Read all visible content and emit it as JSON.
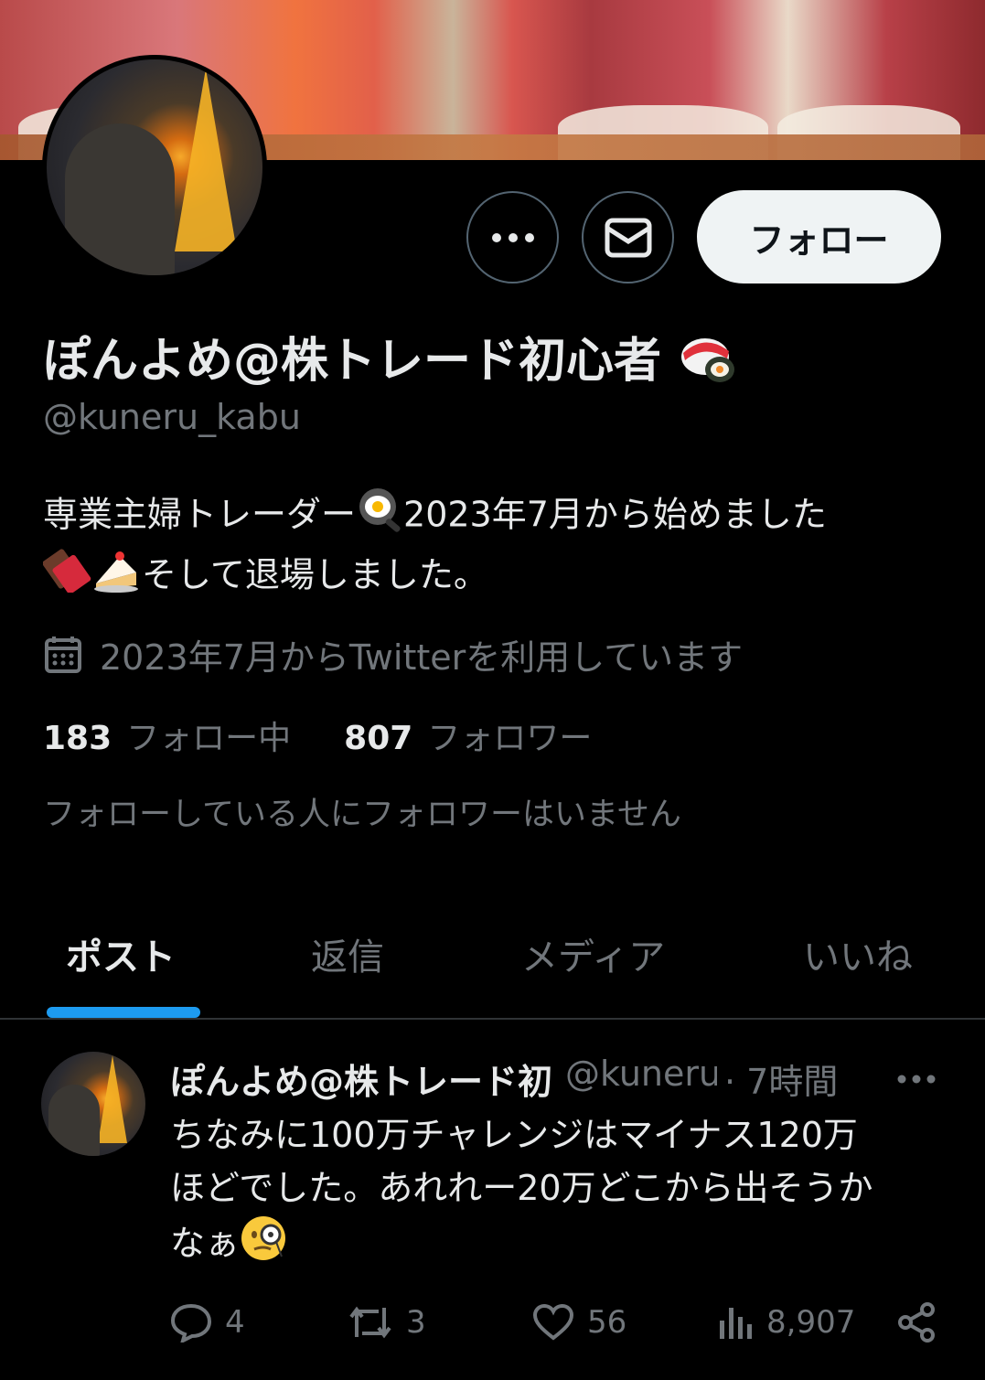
{
  "profile": {
    "display_name": "ぽんよめ@株トレード初心者",
    "handle": "@kuneru_kabu",
    "bio_line1": "専業主婦トレーダー",
    "bio_line1b": "2023年7月から始めました",
    "bio_line2": "そして退場しました。",
    "joined": "2023年7月からTwitterを利用しています",
    "following_count": "183",
    "following_label": "フォロー中",
    "followers_count": "807",
    "followers_label": "フォロワー",
    "no_mutual_followers": "フォローしている人にフォロワーはいません",
    "follow_button": "フォロー"
  },
  "tabs": [
    {
      "label": "ポスト"
    },
    {
      "label": "返信"
    },
    {
      "label": "メディア"
    },
    {
      "label": "いいね"
    }
  ],
  "post": {
    "name": "ぽんよめ@株トレード初",
    "handle": "@kuneru_",
    "time": "· 7時間",
    "text_line1": "ちなみに100万チャレンジはマイナス120万",
    "text_line2": "ほどでした。あれれー20万どこから出そうか",
    "text_line3": "なぁ",
    "replies": "4",
    "reposts": "3",
    "likes": "56",
    "views": "8,907"
  },
  "colors": {
    "background": "#000000",
    "text_primary": "#e7e9ea",
    "text_secondary": "#71767b",
    "accent": "#1d9bf0",
    "follow_button_bg": "#eff3f4"
  },
  "icons": [
    "more-icon",
    "mail-icon",
    "calendar-icon",
    "reply-icon",
    "repost-icon",
    "like-icon",
    "views-icon",
    "share-icon",
    "sushi-emoji",
    "pan-emoji",
    "chocolate-emoji",
    "cake-emoji",
    "monocle-emoji"
  ]
}
